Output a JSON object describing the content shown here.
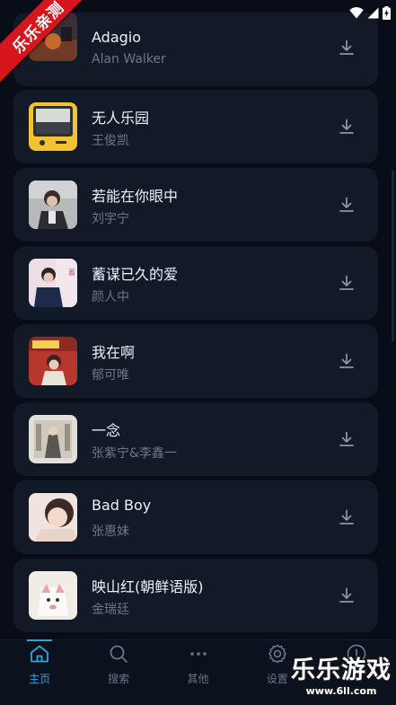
{
  "watermark": {
    "ribbon_text": "乐乐亲测",
    "brand_text": "乐乐游戏",
    "url_text": "www.6ll.com"
  },
  "songs": [
    {
      "title": "Adagio",
      "artist": "Alan Walker",
      "download_icon": "download-icon"
    },
    {
      "title": "无人乐园",
      "artist": "王俊凯",
      "download_icon": "download-icon"
    },
    {
      "title": "若能在你眼中",
      "artist": "刘宇宁",
      "download_icon": "download-icon"
    },
    {
      "title": "蓄谋已久的爱",
      "artist": "颜人中",
      "download_icon": "download-icon"
    },
    {
      "title": "我在啊",
      "artist": "郁可唯",
      "download_icon": "download-icon"
    },
    {
      "title": "一念",
      "artist": "张紫宁&李鑫一",
      "download_icon": "download-icon"
    },
    {
      "title": "Bad Boy",
      "artist": "张惠妹",
      "download_icon": "download-icon"
    },
    {
      "title": "映山红(朝鲜语版)",
      "artist": "金瑞廷",
      "download_icon": "download-icon"
    }
  ],
  "bottom_nav": {
    "items": [
      {
        "label": "主页",
        "icon": "home-icon",
        "active": true
      },
      {
        "label": "搜索",
        "icon": "search-icon",
        "active": false
      },
      {
        "label": "其他",
        "icon": "more-icon",
        "active": false
      },
      {
        "label": "设置",
        "icon": "gear-icon",
        "active": false
      },
      {
        "label": "",
        "icon": "info-icon",
        "active": false
      }
    ]
  },
  "colors": {
    "background": "#080d17",
    "card": "#121a28",
    "accent": "#2ea7d6",
    "muted": "#6c7685"
  }
}
